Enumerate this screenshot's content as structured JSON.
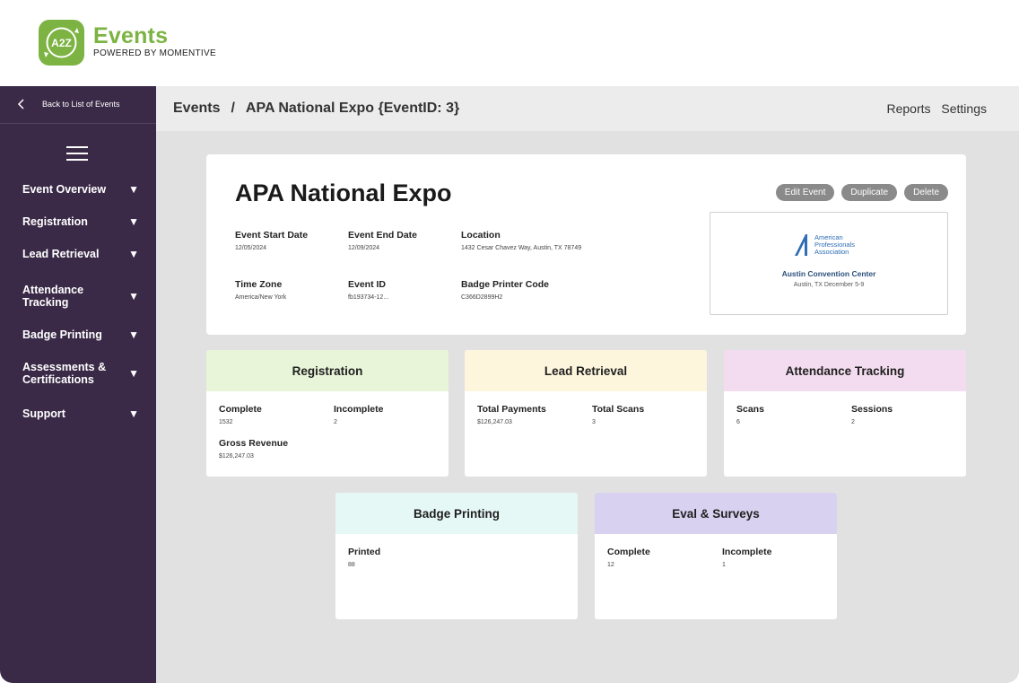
{
  "brand": {
    "title": "Events",
    "subtitle": "POWERED BY MOMENTIVE",
    "logo_text": "A2Z",
    "color": "#7cb342"
  },
  "sidebar": {
    "back_label": "Back to List of Events",
    "items": [
      {
        "label": "Event Overview"
      },
      {
        "label": "Registration"
      },
      {
        "label": "Lead Retrieval"
      },
      {
        "label": "Attendance Tracking"
      },
      {
        "label": "Badge Printing"
      },
      {
        "label": "Assessments & Certifications"
      },
      {
        "label": "Support"
      }
    ],
    "caret": "▼"
  },
  "breadcrumb": {
    "root": "Events",
    "separator": "/",
    "current": "APA National Expo {EventID: 3}"
  },
  "toplinks": {
    "reports": "Reports",
    "settings": "Settings"
  },
  "event": {
    "title": "APA National Expo",
    "fields": {
      "start_date": {
        "label": "Event Start Date",
        "value": "12/05/2024"
      },
      "end_date": {
        "label": "Event End Date",
        "value": "12/09/2024"
      },
      "location": {
        "label": "Location",
        "value": "1432 Cesar Chavez Way, Austin, TX 78749"
      },
      "time_zone": {
        "label": "Time Zone",
        "value": "America/New York"
      },
      "event_id": {
        "label": "Event ID",
        "value": "fb193734-12..."
      },
      "badge_printer": {
        "label": "Badge Printer Code",
        "value": "C366D2899H2"
      }
    },
    "actions": {
      "edit": "Edit Event",
      "duplicate": "Duplicate",
      "delete": "Delete"
    },
    "venue": {
      "logo_text": "American Professionals Association",
      "logo_line1": "American",
      "logo_line2": "Professionals",
      "logo_line3": "Association",
      "name": "Austin Convention Center",
      "detail": "Austin, TX December 5-9"
    }
  },
  "cards": {
    "registration": {
      "title": "Registration",
      "color": "#e8f5d8",
      "stats": [
        {
          "label": "Complete",
          "value": "1532"
        },
        {
          "label": "Incomplete",
          "value": "2"
        },
        {
          "label": "Gross Revenue",
          "value": "$126,247.03"
        }
      ]
    },
    "lead_retrieval": {
      "title": "Lead Retrieval",
      "color": "#fdf6dc",
      "stats": [
        {
          "label": "Total Payments",
          "value": "$126,247.03"
        },
        {
          "label": "Total Scans",
          "value": "3"
        }
      ]
    },
    "attendance": {
      "title": "Attendance Tracking",
      "color": "#f3dcef",
      "stats": [
        {
          "label": "Scans",
          "value": "6"
        },
        {
          "label": "Sessions",
          "value": "2"
        }
      ]
    },
    "badge_printing": {
      "title": "Badge Printing",
      "color": "#e6f8f5",
      "stats": [
        {
          "label": "Printed",
          "value": "88"
        }
      ]
    },
    "eval_surveys": {
      "title": "Eval & Surveys",
      "color": "#d8d2f0",
      "stats": [
        {
          "label": "Complete",
          "value": "12"
        },
        {
          "label": "Incomplete",
          "value": "1"
        }
      ]
    }
  }
}
